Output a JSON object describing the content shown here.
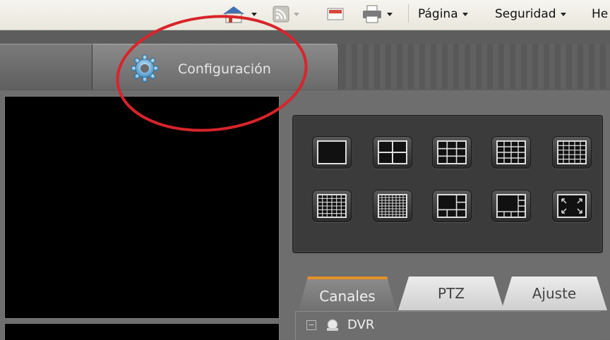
{
  "browser_toolbar": {
    "items": [
      {
        "label": "Página"
      },
      {
        "label": "Seguridad"
      },
      {
        "label": "He"
      }
    ]
  },
  "app": {
    "main_tabs": [
      {
        "label": ""
      },
      {
        "label": "Configuración",
        "icon": "gear-icon"
      }
    ],
    "layout_buttons": [
      {
        "name": "layout-1"
      },
      {
        "name": "layout-4"
      },
      {
        "name": "layout-9"
      },
      {
        "name": "layout-16"
      },
      {
        "name": "layout-25"
      },
      {
        "name": "layout-36"
      },
      {
        "name": "layout-64"
      },
      {
        "name": "layout-1plus5"
      },
      {
        "name": "layout-1plus7"
      },
      {
        "name": "fullscreen"
      }
    ],
    "side_tabs": [
      {
        "label": "Canales",
        "active": true
      },
      {
        "label": "PTZ"
      },
      {
        "label": "Ajuste"
      }
    ],
    "tree": {
      "root_label": "DVR"
    }
  },
  "colors": {
    "annotation": "#d8242a",
    "active_tab_accent": "#e3902a"
  }
}
